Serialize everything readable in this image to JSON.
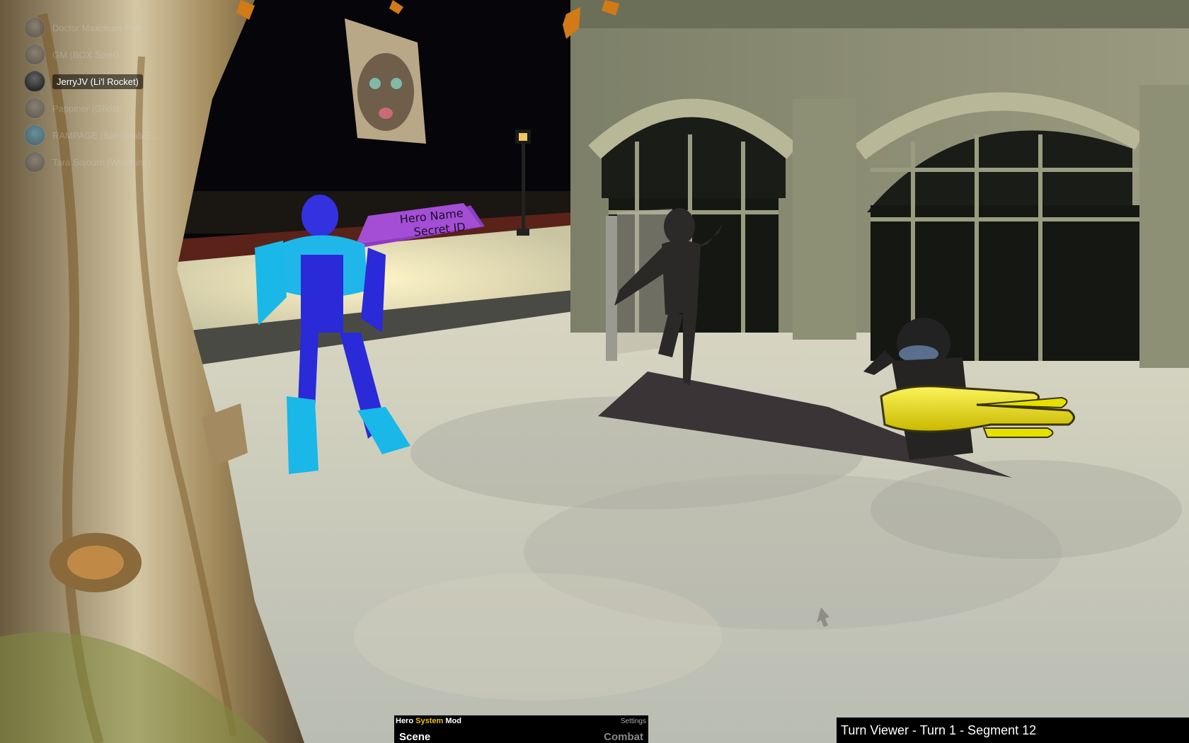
{
  "players": [
    {
      "name": "Doctor Maximum Pain",
      "active": false,
      "variant": "dim"
    },
    {
      "name": "GM (BOX Sixer)",
      "active": false,
      "variant": "dim"
    },
    {
      "name": "JerryJV (Li'l Rocket)",
      "active": true,
      "variant": "active"
    },
    {
      "name": "Pappiner (Ghost)",
      "active": false,
      "variant": "dim"
    },
    {
      "name": "RAMPAGE (Sandcrab/E...",
      "active": false,
      "variant": "blue"
    },
    {
      "name": "Tara Sojourn (Wildthing)",
      "active": false,
      "variant": "dim"
    }
  ],
  "scene": {
    "nameplate_line1": "Hero Name",
    "nameplate_line2": "Secret ID"
  },
  "mod_panel": {
    "title_prefix": "Hero ",
    "title_accent": "System",
    "title_suffix": " Mod",
    "settings_label": "Settings",
    "scene_tab": "Scene",
    "combat_tab": "Combat"
  },
  "turn_viewer": {
    "label": "Turn Viewer - Turn 1 - Segment 12"
  },
  "colors": {
    "accent_yellow": "#e8c020",
    "ground": "#c9c9b8",
    "building": "#8a8c70",
    "hero_blue": "#2a2ad8",
    "hero_cyan": "#19b8e8",
    "giant_hand": "#e6e000",
    "nameplate": "#a44ed6"
  }
}
